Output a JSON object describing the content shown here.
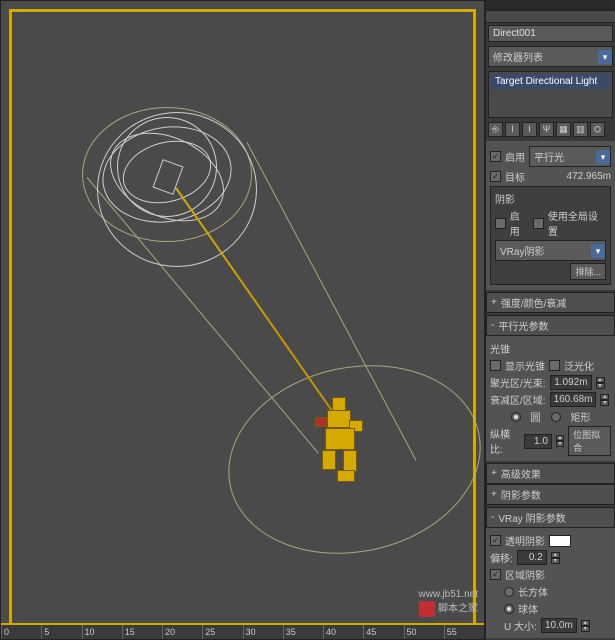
{
  "object_name": "Direct001",
  "modifier_dd": "修改器列表",
  "stack_item": "Target Directional Light",
  "icons": {
    "pin": "⎆",
    "lamp": "I",
    "lamp2": "I",
    "fork": "Ψ",
    "grid": "▦",
    "trash": "▥",
    "cfg": "⛭"
  },
  "general": {
    "enable_label": "启用",
    "light_type": "平行光",
    "target_label": "目标",
    "target_dist": "472.965m"
  },
  "shadows": {
    "title": "阴影",
    "enable_label": "启用",
    "global_label": "使用全局设置",
    "type": "VRay阴影",
    "exclude": "排除..."
  },
  "rollouts": {
    "intensity": "强度/颜色/衰减",
    "parallel": "平行光参数",
    "adv": "高级效果",
    "shadow_params": "阴影参数",
    "vray_shadow": "VRay 阴影参数"
  },
  "parallel": {
    "cone_group": "光锥",
    "show_cone": "显示光锥",
    "overshoot": "泛光化",
    "hotspot_label": "聚光区/光束:",
    "hotspot_val": "1.092m",
    "falloff_label": "衰减区/区域:",
    "falloff_val": "160.68m",
    "shape_circle": "圆",
    "shape_rect": "矩形",
    "aspect_label": "纵横比:",
    "aspect_val": "1.0",
    "bitmap_fit": "位图拟合"
  },
  "vray": {
    "transparent": "透明阴影",
    "bias_label": "偏移:",
    "bias_val": "0.2",
    "area_title": "区域阴影",
    "box": "长方体",
    "sphere": "球体",
    "usize_label": "U 大小:",
    "usize_val": "10.0m"
  },
  "ruler": [
    "0",
    "5",
    "10",
    "15",
    "20",
    "25",
    "30",
    "35",
    "40",
    "45",
    "50",
    "55"
  ],
  "watermark_site": "www.jb51.net",
  "watermark_name": "脚本之家"
}
